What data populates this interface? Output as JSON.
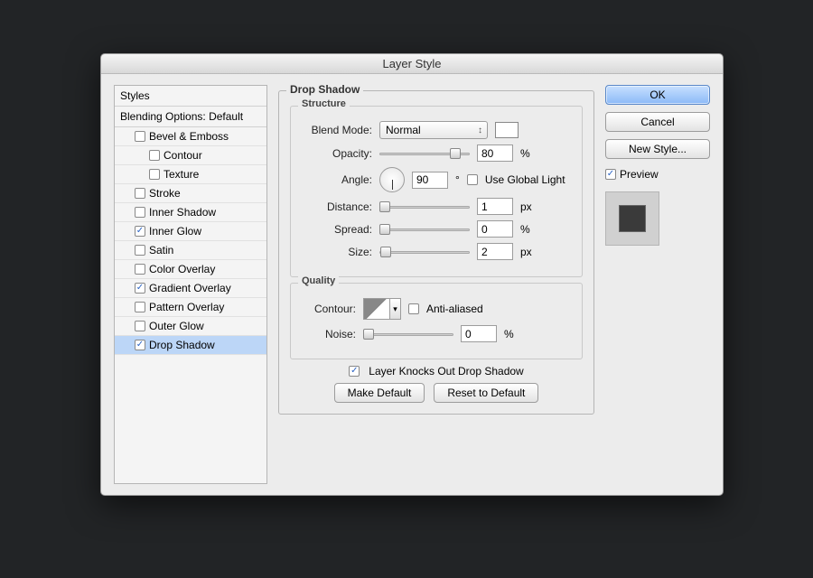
{
  "window": {
    "title": "Layer Style"
  },
  "left": {
    "styles_header": "Styles",
    "blending_header": "Blending Options: Default",
    "items": [
      {
        "label": "Bevel & Emboss",
        "checked": false,
        "indent": 1
      },
      {
        "label": "Contour",
        "checked": false,
        "indent": 2
      },
      {
        "label": "Texture",
        "checked": false,
        "indent": 2
      },
      {
        "label": "Stroke",
        "checked": false,
        "indent": 1
      },
      {
        "label": "Inner Shadow",
        "checked": false,
        "indent": 1
      },
      {
        "label": "Inner Glow",
        "checked": true,
        "indent": 1
      },
      {
        "label": "Satin",
        "checked": false,
        "indent": 1
      },
      {
        "label": "Color Overlay",
        "checked": false,
        "indent": 1
      },
      {
        "label": "Gradient Overlay",
        "checked": true,
        "indent": 1
      },
      {
        "label": "Pattern Overlay",
        "checked": false,
        "indent": 1
      },
      {
        "label": "Outer Glow",
        "checked": false,
        "indent": 1
      },
      {
        "label": "Drop Shadow",
        "checked": true,
        "indent": 1,
        "selected": true
      }
    ]
  },
  "panel": {
    "title": "Drop Shadow",
    "structure": {
      "legend": "Structure",
      "blend_mode_label": "Blend Mode:",
      "blend_mode_value": "Normal",
      "color_hex": "#ffffff",
      "opacity_label": "Opacity:",
      "opacity_value": "80",
      "opacity_suffix": "%",
      "angle_label": "Angle:",
      "angle_value": "90",
      "angle_suffix": "°",
      "use_global_light_label": "Use Global Light",
      "use_global_light_checked": false,
      "distance_label": "Distance:",
      "distance_value": "1",
      "distance_suffix": "px",
      "spread_label": "Spread:",
      "spread_value": "0",
      "spread_suffix": "%",
      "size_label": "Size:",
      "size_value": "2",
      "size_suffix": "px"
    },
    "quality": {
      "legend": "Quality",
      "contour_label": "Contour:",
      "antialiased_label": "Anti-aliased",
      "antialiased_checked": false,
      "noise_label": "Noise:",
      "noise_value": "0",
      "noise_suffix": "%"
    },
    "knockout_label": "Layer Knocks Out Drop Shadow",
    "knockout_checked": true,
    "make_default_label": "Make Default",
    "reset_default_label": "Reset to Default"
  },
  "right": {
    "ok": "OK",
    "cancel": "Cancel",
    "new_style": "New Style...",
    "preview_label": "Preview",
    "preview_checked": true
  }
}
